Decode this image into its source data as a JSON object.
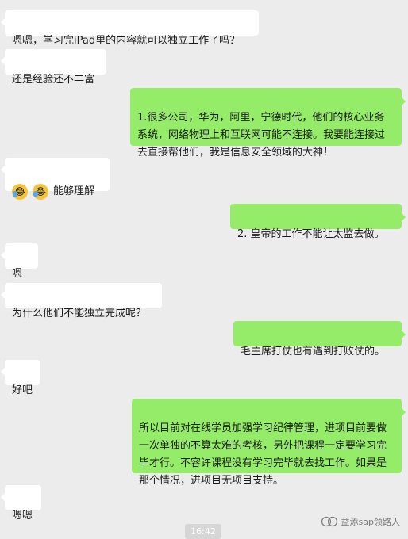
{
  "messages": [
    {
      "side": "left",
      "text": "嗯嗯，学习完iPad里的内容就可以独立工作了吗？"
    },
    {
      "side": "left",
      "text": "还是经验还不丰富"
    },
    {
      "side": "right",
      "text": "1.很多公司，华为，阿里，宁德时代，他们的核心业务系统，网络物理上和互联网可能不连接。我要能连接过去直接帮他们，我是信息安全领域的大神！"
    },
    {
      "side": "left",
      "text": "能够理解",
      "emojis": [
        "laugh-cry-emoji",
        "laugh-cry-emoji"
      ]
    },
    {
      "side": "right",
      "text": "2. 皇帝的工作不能让太监去做。"
    },
    {
      "side": "left",
      "text": "嗯"
    },
    {
      "side": "left",
      "text": "为什么他们不能独立完成呢？"
    },
    {
      "side": "right",
      "text": "毛主席打仗也有遇到打败仗的。"
    },
    {
      "side": "left",
      "text": "好吧"
    },
    {
      "side": "right",
      "text": "所以目前对在线学员加强学习纪律管理，进项目前要做一次单独的不算太难的考核，另外把课程一定要学习完毕才行。不容许课程没有学习完毕就去找工作。如果是那个情况，进项目无项目支持。"
    },
    {
      "side": "left",
      "text": "嗯嗯"
    }
  ],
  "timestamp": "16:42",
  "watermark": "益添sap领路人",
  "colors": {
    "background": "#ececec",
    "sent_bubble": "#95ec69",
    "received_bubble": "#ffffff"
  }
}
